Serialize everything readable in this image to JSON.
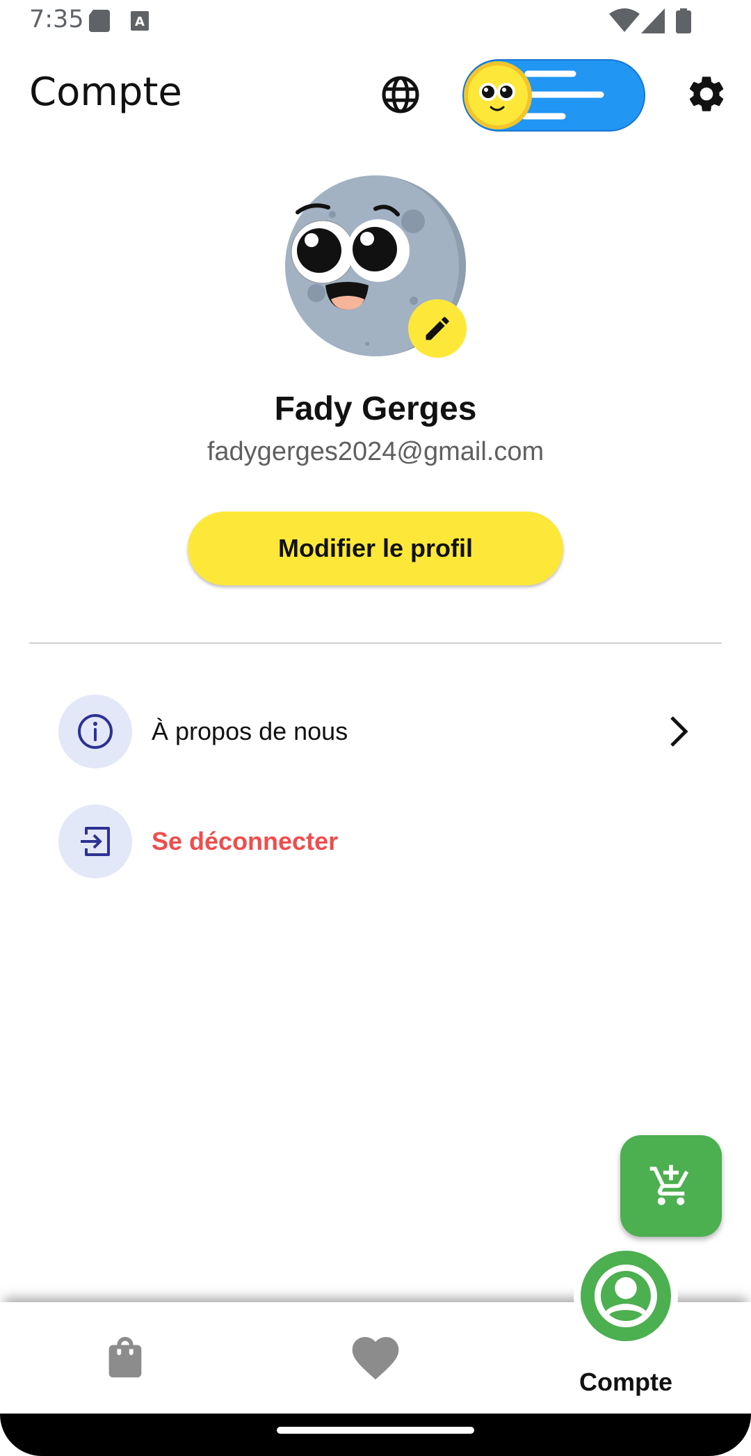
{
  "status_bar": {
    "time": "7:35",
    "icons": [
      "sd-card-icon",
      "keyboard-a-icon",
      "wifi-icon",
      "cell-signal-icon",
      "battery-icon"
    ]
  },
  "app_bar": {
    "title": "Compte",
    "icons": [
      "globe-icon",
      "theme-toggle",
      "gear-icon"
    ]
  },
  "profile": {
    "name": "Fady Gerges",
    "email": "fadygerges2024@gmail.com",
    "edit_profile_label": "Modifier le profil"
  },
  "menu": {
    "items": [
      {
        "label": "À propos de nous",
        "icon": "info-icon"
      },
      {
        "label": "Se déconnecter",
        "icon": "logout-icon"
      }
    ]
  },
  "bottom_nav": {
    "items": [
      {
        "icon": "shopping-bag-icon"
      },
      {
        "icon": "heart-icon"
      },
      {
        "icon": "account-circle-icon",
        "label": "Compte"
      }
    ]
  },
  "colors": {
    "accent_yellow": "#fde83a",
    "fab_green": "#4caf50",
    "logout_red": "#ef4d4d",
    "toggle_blue": "#2196f3",
    "menu_icon_bg": "#e3e8f8",
    "menu_icon_fg": "#2e3192"
  }
}
